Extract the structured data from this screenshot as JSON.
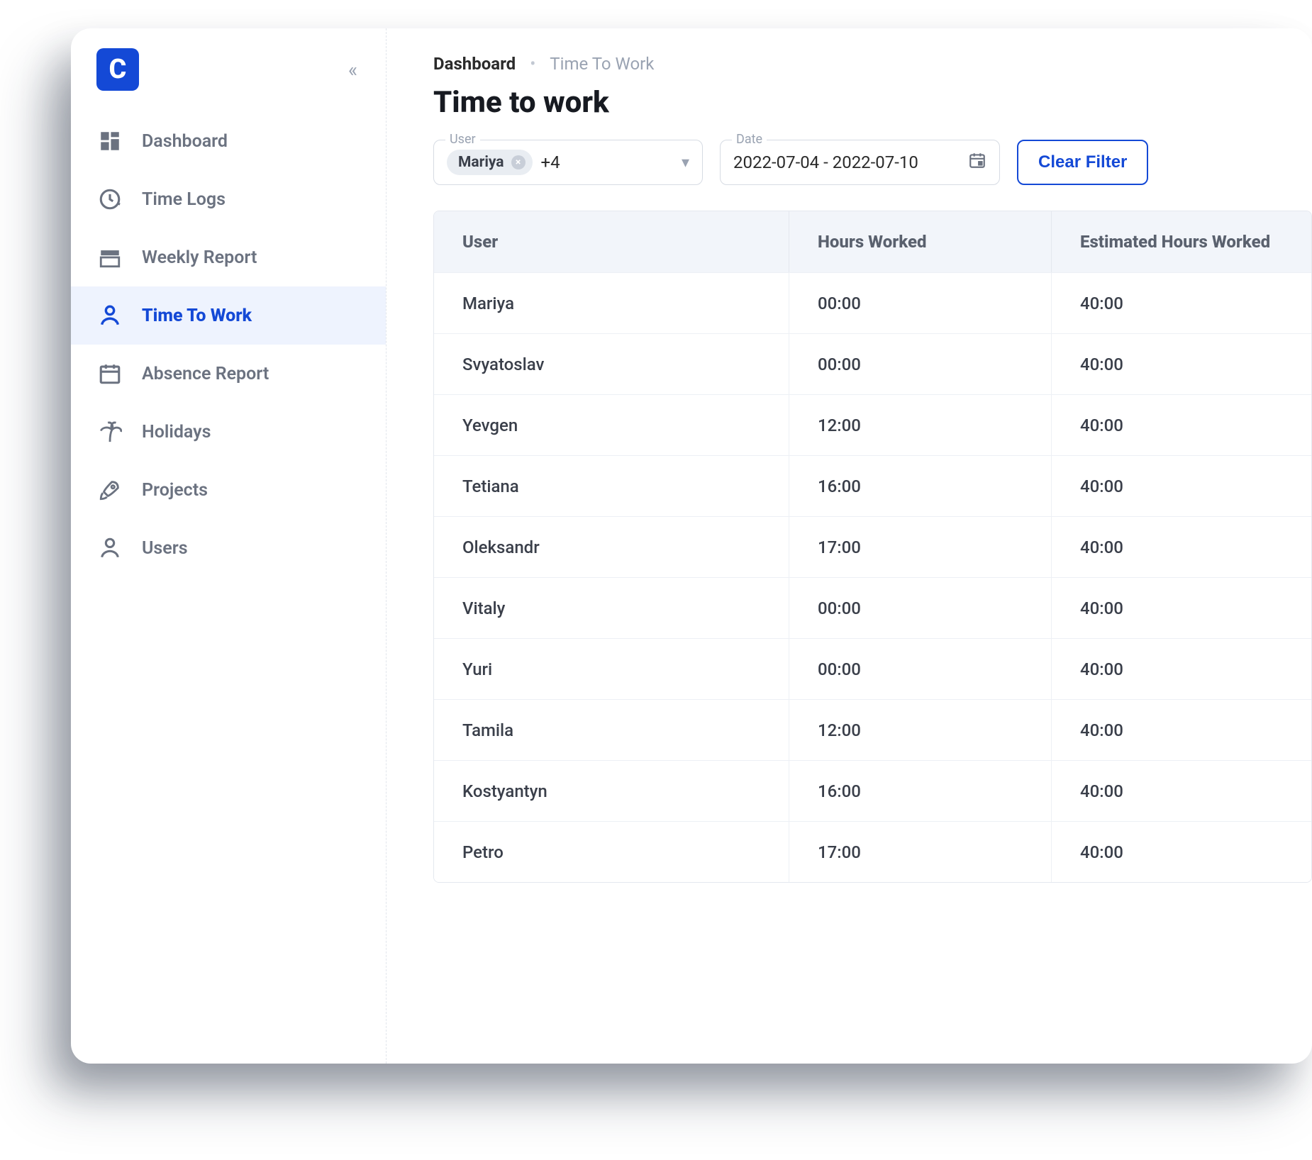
{
  "logo_letter": "C",
  "breadcrumb": {
    "first": "Dashboard",
    "second": "Time To Work"
  },
  "page_title": "Time to work",
  "sidebar": {
    "items": [
      {
        "label": "Dashboard"
      },
      {
        "label": "Time Logs"
      },
      {
        "label": "Weekly Report"
      },
      {
        "label": "Time To Work"
      },
      {
        "label": "Absence Report"
      },
      {
        "label": "Holidays"
      },
      {
        "label": "Projects"
      },
      {
        "label": "Users"
      }
    ]
  },
  "filters": {
    "user_label": "User",
    "user_chip": "Mariya",
    "user_more": "+4",
    "date_label": "Date",
    "date_value": "2022-07-04 - 2022-07-10",
    "clear_label": "Clear Filter"
  },
  "table": {
    "headers": [
      "User",
      "Hours Worked",
      "Estimated Hours Worked"
    ],
    "rows": [
      {
        "user": "Mariya",
        "hours": "00:00",
        "est": "40:00"
      },
      {
        "user": "Svyatoslav",
        "hours": "00:00",
        "est": "40:00"
      },
      {
        "user": "Yevgen",
        "hours": "12:00",
        "est": "40:00"
      },
      {
        "user": "Tetiana",
        "hours": "16:00",
        "est": "40:00"
      },
      {
        "user": "Oleksandr",
        "hours": "17:00",
        "est": "40:00"
      },
      {
        "user": "Vitaly",
        "hours": "00:00",
        "est": "40:00"
      },
      {
        "user": "Yuri",
        "hours": "00:00",
        "est": "40:00"
      },
      {
        "user": "Tamila",
        "hours": "12:00",
        "est": "40:00"
      },
      {
        "user": "Kostyantyn",
        "hours": "16:00",
        "est": "40:00"
      },
      {
        "user": "Petro",
        "hours": "17:00",
        "est": "40:00"
      }
    ]
  }
}
